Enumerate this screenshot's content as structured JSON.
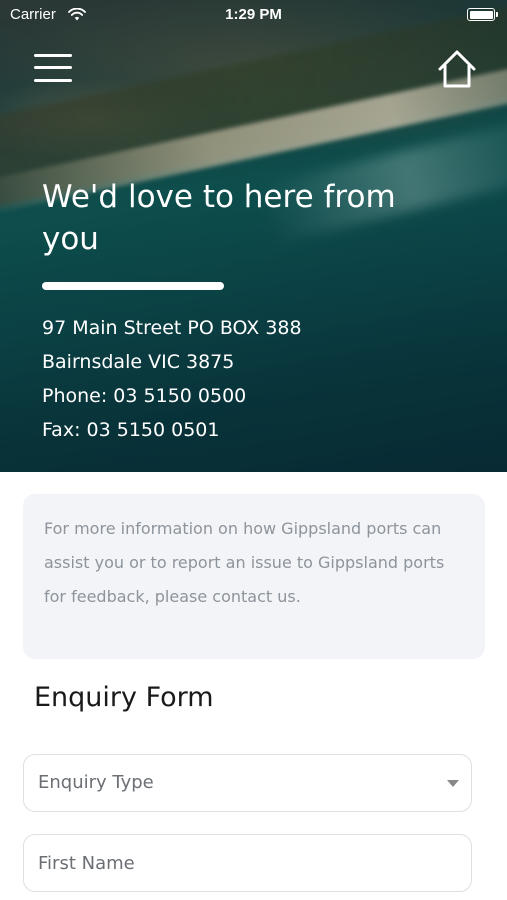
{
  "status_bar": {
    "carrier": "Carrier",
    "time": "1:29 PM"
  },
  "header": {
    "menu_icon": "hamburger-menu-icon",
    "home_icon": "home-icon"
  },
  "hero": {
    "title": "We'd love to here from you",
    "address_line1": "97 Main Street PO BOX 388",
    "address_line2": "Bairnsdale VIC 3875",
    "phone": "Phone:  03 5150 0500",
    "fax": "Fax:  03 5150 0501"
  },
  "info": {
    "text": "For more information on how Gippsland ports can assist you or to report an issue to Gippsland ports for feedback, please contact us."
  },
  "form": {
    "heading": "Enquiry Form",
    "enquiry_type_label": "Enquiry Type",
    "first_name_placeholder": "First Name"
  }
}
